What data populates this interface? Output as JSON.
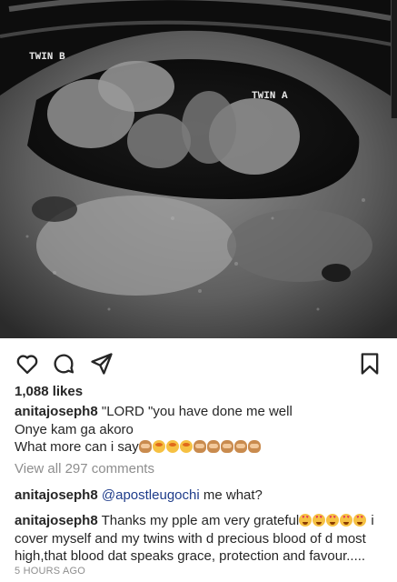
{
  "post": {
    "image_labels": {
      "twin_b": "TWIN B",
      "twin_a": "TWIN A"
    }
  },
  "actions": {
    "like_icon": "heart-icon",
    "comment_icon": "comment-icon",
    "share_icon": "share-icon",
    "save_icon": "bookmark-icon"
  },
  "likes": "1,088 likes",
  "caption": {
    "username": "anitajoseph8",
    "line1": "\"LORD \"you have done me well",
    "line2": "Onye kam ga akoro",
    "line3": "What more can i say"
  },
  "view_all_comments": "View all 297 comments",
  "comments": [
    {
      "username": "anitajoseph8",
      "mention": "@apostleugochi",
      "text": " me what?"
    },
    {
      "username": "anitajoseph8",
      "text_before_emoji": "Thanks my pple am very grateful",
      "text_after_emoji": " i cover myself and my twins with d precious blood of d most high,that blood dat speaks grace, protection and favour....."
    }
  ],
  "timestamp": "5 HOURS AGO",
  "colors": {
    "text": "#262626",
    "muted": "#8e8e8e",
    "mention": "#1e3c8a"
  }
}
